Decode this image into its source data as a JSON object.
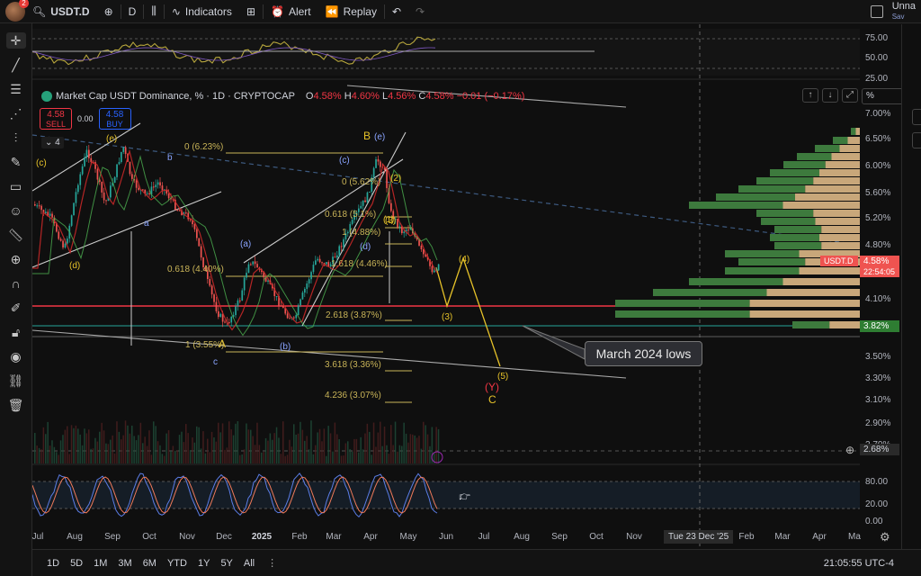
{
  "topbar": {
    "notification_count": "2",
    "symbol": "USDT.D",
    "interval": "D",
    "indicators_label": "Indicators",
    "alert_label": "Alert",
    "replay_label": "Replay",
    "user_name": "Unna",
    "user_sub": "Sav"
  },
  "legend": {
    "title": "Market Cap USDT Dominance, % · 1D · CRYPTOCAP",
    "o_label": "O",
    "o": "4.58%",
    "h_label": "H",
    "h": "4.60%",
    "l_label": "L",
    "l": "4.56%",
    "c_label": "C",
    "c": "4.58%",
    "change": "−0.01 (−0.17%)",
    "sell_price": "4.58",
    "sell_label": "SELL",
    "spread": "0.00",
    "buy_price": "4.58",
    "buy_label": "BUY",
    "collapse_count": "4",
    "scale_input": "%"
  },
  "rsi_axis": [
    "75.00",
    "50.00",
    "25.00"
  ],
  "price_axis": [
    "7.00%",
    "6.50%",
    "6.00%",
    "5.60%",
    "5.20%",
    "4.80%",
    "4.10%",
    "3.50%",
    "3.30%",
    "3.10%",
    "2.90%",
    "2.70%"
  ],
  "price_tags": {
    "symbol_tag": "USDT.D",
    "current": "4.58%",
    "countdown": "22:54:05",
    "level_382": "3.82%",
    "crosshair": "2.68%"
  },
  "stoch_axis": [
    "80.00",
    "20.00",
    "0.00"
  ],
  "time_axis": [
    "Jul",
    "Aug",
    "Sep",
    "Oct",
    "Nov",
    "Dec",
    "2025",
    "Feb",
    "Mar",
    "Apr",
    "May",
    "Jun",
    "Jul",
    "Aug",
    "Sep",
    "Oct",
    "Nov",
    "Feb",
    "Mar",
    "Apr",
    "Ma"
  ],
  "time_cursor": "Tue 23 Dec '25",
  "fib_labels": {
    "f0_top": "0 (6.23%)",
    "f0618_left": "0.618 (4.40%)",
    "f1_left": "1 (3.55%)",
    "f0_mid": "0 (5.62%)",
    "f0618_mid": "0.618 (5.1%)",
    "f1_mid": "1 (4.88%)",
    "f1618_mid": "1.618 (4.46%)",
    "f2618": "2.618 (3.87%)",
    "f3618": "3.618 (3.36%)",
    "f4236": "4.236 (3.07%)"
  },
  "wave_labels": {
    "c_paren_left": "(c)",
    "d_paren_left": "(d)",
    "e_paren_left": "(e)",
    "b_small": "b",
    "a_small": "a",
    "c_small": "c",
    "A": "A",
    "B": "B",
    "a_paren": "(a)",
    "b_paren": "(b)",
    "c_paren": "(c)",
    "d_paren": "(d)",
    "e_paren": "(e)",
    "w1": "(1)",
    "w2": "(2)",
    "w3": "(3)",
    "w4": "(4)",
    "w5": "(5)",
    "w3_proj": "(3)",
    "Y": "(Y)",
    "C": "C"
  },
  "callout": "March 2024 lows",
  "bottombar": {
    "ranges": [
      "1D",
      "5D",
      "1M",
      "3M",
      "6M",
      "YTD",
      "1Y",
      "5Y",
      "All"
    ],
    "clock": "21:05:55 UTC-4"
  },
  "colors": {
    "up": "#26a69a",
    "down": "#ef5350",
    "fib": "#c9b458",
    "projection": "#e6c229",
    "support": "#f23645",
    "rsi": "#b7a63c",
    "stoch_k": "#5b7de6",
    "stoch_d": "#ef7a5a"
  }
}
